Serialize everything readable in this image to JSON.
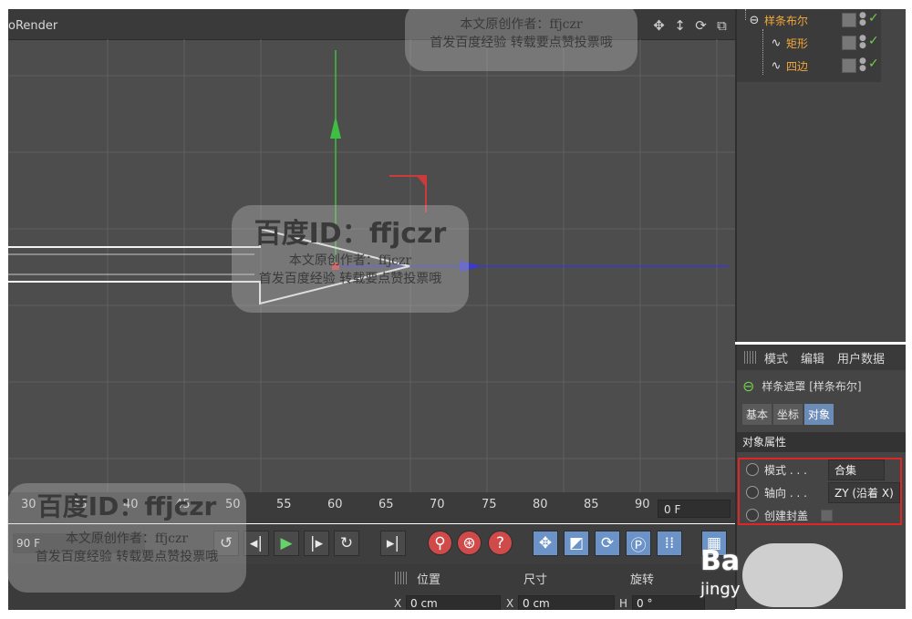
{
  "viewport": {
    "title": "oRender",
    "nav_icons": [
      "move-view-icon",
      "dolly-icon",
      "orbit-icon",
      "fullscreen-icon"
    ]
  },
  "object_manager": {
    "items": [
      {
        "name": "样条布尔",
        "icon": "spline-boolean-icon"
      },
      {
        "name": "矩形",
        "icon": "spline-icon"
      },
      {
        "name": "四边",
        "icon": "spline-icon"
      }
    ]
  },
  "attribute_manager": {
    "menu": [
      "模式",
      "编辑",
      "用户数据"
    ],
    "title": "样条遮罩 [样条布尔]",
    "tabs": [
      "基本",
      "坐标",
      "对象"
    ],
    "active_tab": "对象",
    "section": "对象属性",
    "rows": [
      {
        "label": "模式 . . .",
        "value": "合集"
      },
      {
        "label": "轴向 . . .",
        "value": "ZY (沿着 X)"
      },
      {
        "label": "创建封盖",
        "value": ""
      }
    ]
  },
  "timeline": {
    "ticks": [
      "30",
      "35",
      "40",
      "45",
      "50",
      "55",
      "60",
      "65",
      "70",
      "75",
      "80",
      "85",
      "90"
    ],
    "current_frame": "0 F"
  },
  "transport": {
    "fps_field": "90 F"
  },
  "coordinates": {
    "headers": [
      "位置",
      "尺寸",
      "旋转"
    ],
    "axis_x": "X",
    "axis_h": "H",
    "pos_x": "0 cm",
    "size_x": "0 cm",
    "rot_h": "0 °"
  },
  "watermarks": {
    "id_text": "百度ID：ffjczr",
    "line1": "本文原创作者：ffjczr",
    "line2": "首发百度经验 转载要点赞投票哦",
    "brand": "Ba",
    "brand_sub": "jingy"
  },
  "colors": {
    "viewport_bg": "#4d4d4d",
    "grid": "#5f5f5f",
    "axis_y": "#3fbf3f",
    "axis_x": "#3a3ad0",
    "highlight": "#e02525",
    "name_orange": "#f2a83a"
  }
}
